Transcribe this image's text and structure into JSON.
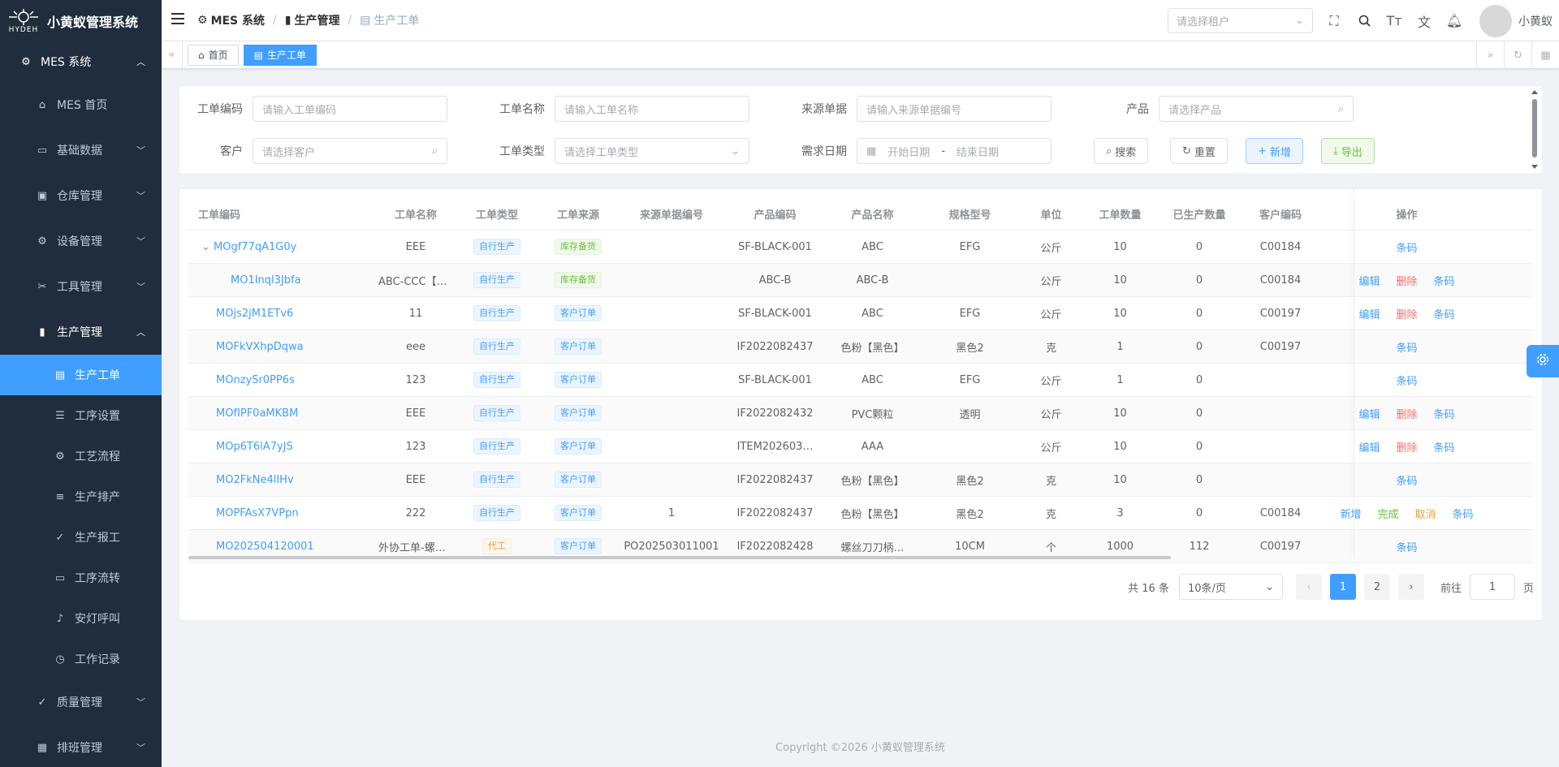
{
  "app": {
    "logo_text": "HYDEH",
    "title": "小黄蚁管理系统"
  },
  "sidebar": {
    "root": {
      "label": "MES 系统",
      "icon": "chip-icon"
    },
    "items": [
      {
        "label": "MES 首页",
        "icon": "home-icon",
        "type": "leaf"
      },
      {
        "label": "基础数据",
        "icon": "monitor-icon",
        "type": "group"
      },
      {
        "label": "仓库管理",
        "icon": "warehouse-icon",
        "type": "group"
      },
      {
        "label": "设备管理",
        "icon": "cpu-icon",
        "type": "group"
      },
      {
        "label": "工具管理",
        "icon": "tools-icon",
        "type": "group"
      },
      {
        "label": "生产管理",
        "icon": "factory-icon",
        "type": "group-open"
      },
      {
        "label": "生产工单",
        "icon": "document-icon",
        "type": "sub-active"
      },
      {
        "label": "工序设置",
        "icon": "sliders-icon",
        "type": "sub"
      },
      {
        "label": "工艺流程",
        "icon": "chip-icon",
        "type": "sub"
      },
      {
        "label": "生产排产",
        "icon": "schedule-icon",
        "type": "sub"
      },
      {
        "label": "生产报工",
        "icon": "report-icon",
        "type": "sub"
      },
      {
        "label": "工序流转",
        "icon": "transfer-icon",
        "type": "sub"
      },
      {
        "label": "安灯呼叫",
        "icon": "bell-icon",
        "type": "sub"
      },
      {
        "label": "工作记录",
        "icon": "clock-icon",
        "type": "sub"
      },
      {
        "label": "质量管理",
        "icon": "check-icon",
        "type": "group"
      },
      {
        "label": "排班管理",
        "icon": "calendar-icon",
        "type": "group"
      }
    ]
  },
  "header": {
    "breadcrumb": [
      {
        "label": "MES 系统",
        "icon": "chip-icon"
      },
      {
        "label": "生产管理",
        "icon": "factory-icon"
      },
      {
        "label": "生产工单",
        "icon": "document-icon"
      }
    ],
    "tenant_placeholder": "请选择租户",
    "username": "小黄蚁"
  },
  "tags": [
    {
      "label": "首页",
      "icon": "home-icon"
    },
    {
      "label": "生产工单",
      "icon": "document-icon"
    }
  ],
  "search": {
    "fields": [
      {
        "label": "工单编码",
        "placeholder": "请输入工单编码"
      },
      {
        "label": "工单名称",
        "placeholder": "请输入工单名称"
      },
      {
        "label": "来源单据",
        "placeholder": "请输入来源单据编号"
      },
      {
        "label": "产品",
        "placeholder": "请选择产品"
      },
      {
        "label": "客户",
        "placeholder": "请选择客户"
      },
      {
        "label": "工单类型",
        "placeholder": "请选择工单类型"
      },
      {
        "label": "需求日期",
        "start": "开始日期",
        "sep": "-",
        "end": "结束日期"
      }
    ],
    "buttons": {
      "search": "搜索",
      "reset": "重置",
      "add": "新增",
      "export": "导出"
    }
  },
  "table": {
    "headers": [
      "工单编码",
      "工单名称",
      "工单类型",
      "工单来源",
      "来源单据编号",
      "产品编码",
      "产品名称",
      "规格型号",
      "单位",
      "工单数量",
      "已生产数量",
      "客户编码",
      "操作"
    ],
    "rows": [
      {
        "code": "MOgf77qA1G0y",
        "name": "EEE",
        "type": "自行生产",
        "source": "库存备货",
        "src_no": "",
        "pcode": "SF-BLACK-001",
        "pname": "ABC",
        "spec": "EFG",
        "unit": "公斤",
        "qty": "10",
        "done": "0",
        "cust": "C00184",
        "ops": [
          "条码"
        ],
        "expand": true,
        "indent": false,
        "type_color": "blue",
        "source_color": "green"
      },
      {
        "code": "MO1Inql3Jbfa",
        "name": "ABC-CCC【10】…",
        "type": "自行生产",
        "source": "库存备货",
        "src_no": "",
        "pcode": "ABC-B",
        "pname": "ABC-B",
        "spec": "",
        "unit": "公斤",
        "qty": "10",
        "done": "0",
        "cust": "C00184",
        "ops": [
          "编辑",
          "删除",
          "条码"
        ],
        "expand": false,
        "indent": true,
        "type_color": "blue",
        "source_color": "green"
      },
      {
        "code": "MOjs2jM1ETv6",
        "name": "11",
        "type": "自行生产",
        "source": "客户订单",
        "src_no": "",
        "pcode": "SF-BLACK-001",
        "pname": "ABC",
        "spec": "EFG",
        "unit": "公斤",
        "qty": "10",
        "done": "0",
        "cust": "C00197",
        "ops": [
          "编辑",
          "删除",
          "条码"
        ],
        "expand": false,
        "indent": false,
        "type_color": "blue",
        "source_color": "blue"
      },
      {
        "code": "MOFkVXhpDqwa",
        "name": "eee",
        "type": "自行生产",
        "source": "客户订单",
        "src_no": "",
        "pcode": "IF2022082437",
        "pname": "色粉【黑色】",
        "spec": "黑色2",
        "unit": "克",
        "qty": "1",
        "done": "0",
        "cust": "C00197",
        "ops": [
          "条码"
        ],
        "expand": false,
        "indent": false,
        "type_color": "blue",
        "source_color": "blue"
      },
      {
        "code": "MOnzySr0PP6s",
        "name": "123",
        "type": "自行生产",
        "source": "客户订单",
        "src_no": "",
        "pcode": "SF-BLACK-001",
        "pname": "ABC",
        "spec": "EFG",
        "unit": "公斤",
        "qty": "1",
        "done": "0",
        "cust": "",
        "ops": [
          "条码"
        ],
        "expand": false,
        "indent": false,
        "type_color": "blue",
        "source_color": "blue"
      },
      {
        "code": "MOfIPF0aMKBM",
        "name": "EEE",
        "type": "自行生产",
        "source": "客户订单",
        "src_no": "",
        "pcode": "IF2022082432",
        "pname": "PVC颗粒",
        "spec": "透明",
        "unit": "公斤",
        "qty": "10",
        "done": "0",
        "cust": "",
        "ops": [
          "编辑",
          "删除",
          "条码"
        ],
        "expand": false,
        "indent": false,
        "type_color": "blue",
        "source_color": "blue"
      },
      {
        "code": "MOp6T6lA7yJS",
        "name": "123",
        "type": "自行生产",
        "source": "客户订单",
        "src_no": "",
        "pcode": "ITEM202603…",
        "pname": "AAA",
        "spec": "",
        "unit": "公斤",
        "qty": "10",
        "done": "0",
        "cust": "",
        "ops": [
          "编辑",
          "删除",
          "条码"
        ],
        "expand": false,
        "indent": false,
        "type_color": "blue",
        "source_color": "blue"
      },
      {
        "code": "MO2FkNe4lIHv",
        "name": "EEE",
        "type": "自行生产",
        "source": "客户订单",
        "src_no": "",
        "pcode": "IF2022082437",
        "pname": "色粉【黑色】",
        "spec": "黑色2",
        "unit": "克",
        "qty": "10",
        "done": "0",
        "cust": "",
        "ops": [
          "条码"
        ],
        "expand": false,
        "indent": false,
        "type_color": "blue",
        "source_color": "blue"
      },
      {
        "code": "MOPFAsX7VPpn",
        "name": "222",
        "type": "自行生产",
        "source": "客户订单",
        "src_no": "1",
        "pcode": "IF2022082437",
        "pname": "色粉【黑色】",
        "spec": "黑色2",
        "unit": "克",
        "qty": "3",
        "done": "0",
        "cust": "C00184",
        "ops": [
          "新增",
          "完成",
          "取消",
          "条码"
        ],
        "expand": false,
        "indent": false,
        "type_color": "blue",
        "source_color": "blue"
      },
      {
        "code": "MO202504120001",
        "name": "外协工单-螺丝刀…",
        "type": "代工",
        "source": "客户订单",
        "src_no": "PO202503011001",
        "pcode": "IF2022082428",
        "pname": "螺丝刀刀柄…",
        "spec": "10CM",
        "unit": "个",
        "qty": "1000",
        "done": "112",
        "cust": "C00197",
        "ops": [
          "条码"
        ],
        "expand": false,
        "indent": false,
        "type_color": "orange",
        "source_color": "blue"
      }
    ]
  },
  "pagination": {
    "total": "共 16 条",
    "size": "10条/页",
    "pages": [
      "1",
      "2"
    ],
    "current": "1",
    "goto_label": "前往",
    "goto_value": "1",
    "page_suffix": "页"
  },
  "footer": {
    "copyright": "Copyright ©2026 小黄蚁管理系统"
  }
}
